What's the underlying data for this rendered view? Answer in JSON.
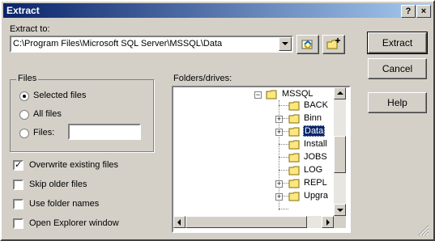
{
  "window": {
    "title": "Extract"
  },
  "titlebar_buttons": {
    "help": "?",
    "close": "×"
  },
  "extract_to": {
    "label": "Extract to:",
    "value": "C:\\Program Files\\Microsoft SQL Server\\MSSQL\\Data"
  },
  "buttons": {
    "extract": "Extract",
    "cancel": "Cancel",
    "help": "Help"
  },
  "files_group": {
    "title": "Files",
    "selected": "Selected files",
    "all": "All files",
    "files": "Files:",
    "files_value": ""
  },
  "folders": {
    "label": "Folders/drives:",
    "items": [
      "MSSQL",
      "BACK",
      "Binn",
      "Data",
      "Install",
      "JOBS",
      "LOG",
      "REPL",
      "Upgra"
    ]
  },
  "options": {
    "overwrite": "Overwrite existing files",
    "skip_older": "Skip older files",
    "use_folder_names": "Use folder names",
    "open_explorer": "Open Explorer window"
  },
  "colors": {
    "titlebar_start": "#0a246a",
    "titlebar_end": "#a6caf0",
    "selection": "#0a246a"
  }
}
